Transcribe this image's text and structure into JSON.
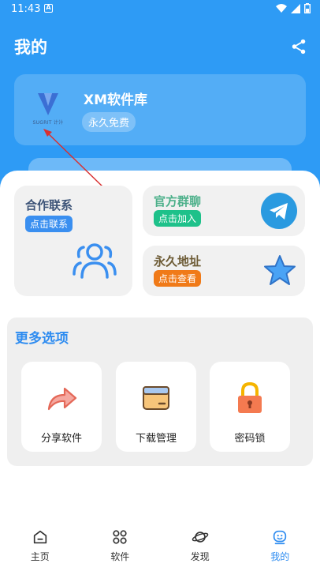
{
  "status_bar": {
    "time": "11:43",
    "notif": "A"
  },
  "header": {
    "title": "我的"
  },
  "profile": {
    "name": "XM软件库",
    "badge": "永久免费",
    "logo_text": "SUGRIT 计汁"
  },
  "cards": {
    "cooperation": {
      "title": "合作联系",
      "action": "点击联系"
    },
    "group": {
      "title": "官方群聊",
      "action": "点击加入"
    },
    "address": {
      "title": "永久地址",
      "action": "点击查看"
    }
  },
  "more": {
    "title": "更多选项",
    "options": [
      {
        "label": "分享软件",
        "icon": "share-arrow-icon"
      },
      {
        "label": "下载管理",
        "icon": "folder-icon"
      },
      {
        "label": "密码锁",
        "icon": "lock-icon"
      }
    ]
  },
  "nav": {
    "items": [
      {
        "label": "主页",
        "icon": "home-icon"
      },
      {
        "label": "软件",
        "icon": "apps-icon"
      },
      {
        "label": "发现",
        "icon": "planet-icon"
      },
      {
        "label": "我的",
        "icon": "profile-icon"
      }
    ],
    "active_index": 3
  },
  "colors": {
    "primary": "#2e9bf5",
    "group_accent": "#1ec18a",
    "address_accent": "#f07a18",
    "coop_accent": "#3a8ff0"
  }
}
